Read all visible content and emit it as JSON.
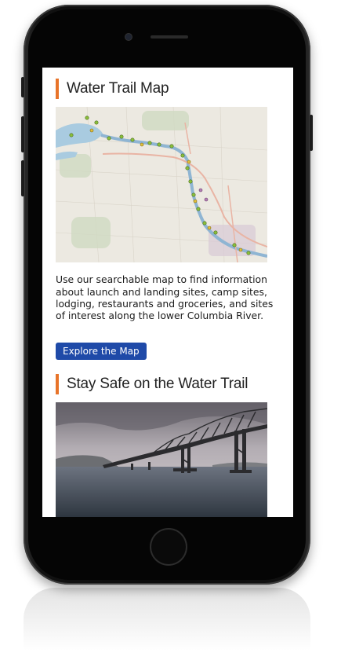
{
  "sections": [
    {
      "title": "Water Trail Map",
      "description": "Use our searchable map to find information about launch and landing sites, camp sites, lodging, restaurants and groceries, and sites of interest along the lower Columbia River.",
      "button_label": "Explore the Map"
    },
    {
      "title": "Stay Safe on the Water Trail"
    }
  ],
  "colors": {
    "accent": "#e8742a",
    "button": "#1f4aa8"
  }
}
